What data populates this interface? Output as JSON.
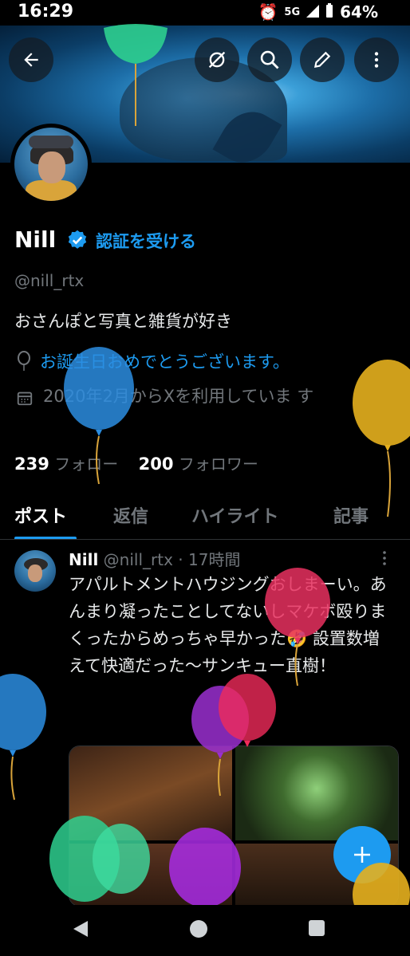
{
  "status_bar": {
    "time": "16:29",
    "network": "5G",
    "battery": "64%"
  },
  "profile": {
    "name": "Nill",
    "verify_link": "認証を受ける",
    "handle": "@nill_rtx",
    "bio": "おさんぽと写真と雑貨が好き",
    "birthday_text": "お誕生日おめでとうございます。",
    "joined_text": "2020年2月からXを利用していま す",
    "following_count": "239",
    "following_label": "フォロー",
    "followers_count": "200",
    "followers_label": "フォロワー"
  },
  "tabs": [
    {
      "label": "ポスト"
    },
    {
      "label": "返信"
    },
    {
      "label": "ハイライト"
    },
    {
      "label": "記事"
    }
  ],
  "post": {
    "author": "Nill",
    "handle": "@nill_rtx",
    "time": "· 17時間",
    "text": "アパルトメントハウジングおしまーい。あんまり凝ったことしてないしマケボ殴りまくったからめっちゃ早かった🤣 設置数増えて快適だった〜サンキュー直樹！"
  },
  "colors": {
    "accent": "#1d9bf0",
    "background": "#000000",
    "muted": "#71767b"
  },
  "icons": [
    "back-arrow-icon",
    "hide-icon",
    "search-icon",
    "edit-icon",
    "more-icon",
    "verified-badge-icon",
    "balloon-location-icon",
    "calendar-icon",
    "plus-icon",
    "nav-back-icon",
    "nav-home-icon",
    "nav-recents-icon"
  ]
}
